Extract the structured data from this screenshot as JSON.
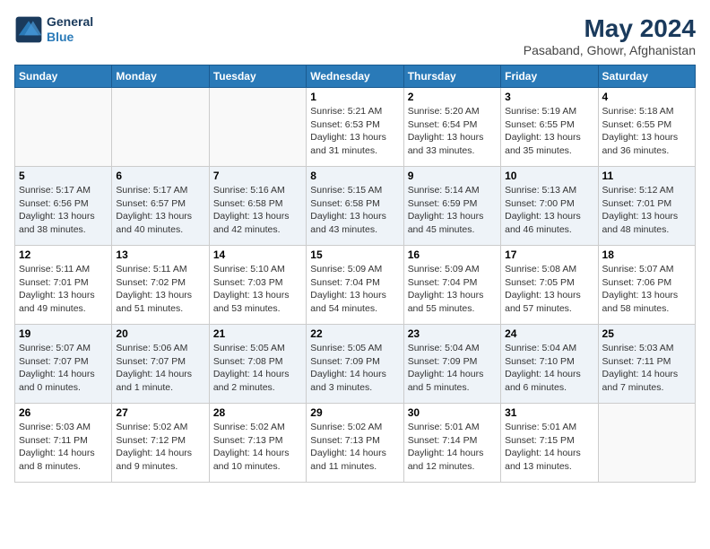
{
  "header": {
    "logo_line1": "General",
    "logo_line2": "Blue",
    "title": "May 2024",
    "subtitle": "Pasaband, Ghowr, Afghanistan"
  },
  "weekdays": [
    "Sunday",
    "Monday",
    "Tuesday",
    "Wednesday",
    "Thursday",
    "Friday",
    "Saturday"
  ],
  "weeks": [
    [
      {
        "day": "",
        "sunrise": "",
        "sunset": "",
        "daylight": ""
      },
      {
        "day": "",
        "sunrise": "",
        "sunset": "",
        "daylight": ""
      },
      {
        "day": "",
        "sunrise": "",
        "sunset": "",
        "daylight": ""
      },
      {
        "day": "1",
        "sunrise": "Sunrise: 5:21 AM",
        "sunset": "Sunset: 6:53 PM",
        "daylight": "Daylight: 13 hours and 31 minutes."
      },
      {
        "day": "2",
        "sunrise": "Sunrise: 5:20 AM",
        "sunset": "Sunset: 6:54 PM",
        "daylight": "Daylight: 13 hours and 33 minutes."
      },
      {
        "day": "3",
        "sunrise": "Sunrise: 5:19 AM",
        "sunset": "Sunset: 6:55 PM",
        "daylight": "Daylight: 13 hours and 35 minutes."
      },
      {
        "day": "4",
        "sunrise": "Sunrise: 5:18 AM",
        "sunset": "Sunset: 6:55 PM",
        "daylight": "Daylight: 13 hours and 36 minutes."
      }
    ],
    [
      {
        "day": "5",
        "sunrise": "Sunrise: 5:17 AM",
        "sunset": "Sunset: 6:56 PM",
        "daylight": "Daylight: 13 hours and 38 minutes."
      },
      {
        "day": "6",
        "sunrise": "Sunrise: 5:17 AM",
        "sunset": "Sunset: 6:57 PM",
        "daylight": "Daylight: 13 hours and 40 minutes."
      },
      {
        "day": "7",
        "sunrise": "Sunrise: 5:16 AM",
        "sunset": "Sunset: 6:58 PM",
        "daylight": "Daylight: 13 hours and 42 minutes."
      },
      {
        "day": "8",
        "sunrise": "Sunrise: 5:15 AM",
        "sunset": "Sunset: 6:58 PM",
        "daylight": "Daylight: 13 hours and 43 minutes."
      },
      {
        "day": "9",
        "sunrise": "Sunrise: 5:14 AM",
        "sunset": "Sunset: 6:59 PM",
        "daylight": "Daylight: 13 hours and 45 minutes."
      },
      {
        "day": "10",
        "sunrise": "Sunrise: 5:13 AM",
        "sunset": "Sunset: 7:00 PM",
        "daylight": "Daylight: 13 hours and 46 minutes."
      },
      {
        "day": "11",
        "sunrise": "Sunrise: 5:12 AM",
        "sunset": "Sunset: 7:01 PM",
        "daylight": "Daylight: 13 hours and 48 minutes."
      }
    ],
    [
      {
        "day": "12",
        "sunrise": "Sunrise: 5:11 AM",
        "sunset": "Sunset: 7:01 PM",
        "daylight": "Daylight: 13 hours and 49 minutes."
      },
      {
        "day": "13",
        "sunrise": "Sunrise: 5:11 AM",
        "sunset": "Sunset: 7:02 PM",
        "daylight": "Daylight: 13 hours and 51 minutes."
      },
      {
        "day": "14",
        "sunrise": "Sunrise: 5:10 AM",
        "sunset": "Sunset: 7:03 PM",
        "daylight": "Daylight: 13 hours and 53 minutes."
      },
      {
        "day": "15",
        "sunrise": "Sunrise: 5:09 AM",
        "sunset": "Sunset: 7:04 PM",
        "daylight": "Daylight: 13 hours and 54 minutes."
      },
      {
        "day": "16",
        "sunrise": "Sunrise: 5:09 AM",
        "sunset": "Sunset: 7:04 PM",
        "daylight": "Daylight: 13 hours and 55 minutes."
      },
      {
        "day": "17",
        "sunrise": "Sunrise: 5:08 AM",
        "sunset": "Sunset: 7:05 PM",
        "daylight": "Daylight: 13 hours and 57 minutes."
      },
      {
        "day": "18",
        "sunrise": "Sunrise: 5:07 AM",
        "sunset": "Sunset: 7:06 PM",
        "daylight": "Daylight: 13 hours and 58 minutes."
      }
    ],
    [
      {
        "day": "19",
        "sunrise": "Sunrise: 5:07 AM",
        "sunset": "Sunset: 7:07 PM",
        "daylight": "Daylight: 14 hours and 0 minutes."
      },
      {
        "day": "20",
        "sunrise": "Sunrise: 5:06 AM",
        "sunset": "Sunset: 7:07 PM",
        "daylight": "Daylight: 14 hours and 1 minute."
      },
      {
        "day": "21",
        "sunrise": "Sunrise: 5:05 AM",
        "sunset": "Sunset: 7:08 PM",
        "daylight": "Daylight: 14 hours and 2 minutes."
      },
      {
        "day": "22",
        "sunrise": "Sunrise: 5:05 AM",
        "sunset": "Sunset: 7:09 PM",
        "daylight": "Daylight: 14 hours and 3 minutes."
      },
      {
        "day": "23",
        "sunrise": "Sunrise: 5:04 AM",
        "sunset": "Sunset: 7:09 PM",
        "daylight": "Daylight: 14 hours and 5 minutes."
      },
      {
        "day": "24",
        "sunrise": "Sunrise: 5:04 AM",
        "sunset": "Sunset: 7:10 PM",
        "daylight": "Daylight: 14 hours and 6 minutes."
      },
      {
        "day": "25",
        "sunrise": "Sunrise: 5:03 AM",
        "sunset": "Sunset: 7:11 PM",
        "daylight": "Daylight: 14 hours and 7 minutes."
      }
    ],
    [
      {
        "day": "26",
        "sunrise": "Sunrise: 5:03 AM",
        "sunset": "Sunset: 7:11 PM",
        "daylight": "Daylight: 14 hours and 8 minutes."
      },
      {
        "day": "27",
        "sunrise": "Sunrise: 5:02 AM",
        "sunset": "Sunset: 7:12 PM",
        "daylight": "Daylight: 14 hours and 9 minutes."
      },
      {
        "day": "28",
        "sunrise": "Sunrise: 5:02 AM",
        "sunset": "Sunset: 7:13 PM",
        "daylight": "Daylight: 14 hours and 10 minutes."
      },
      {
        "day": "29",
        "sunrise": "Sunrise: 5:02 AM",
        "sunset": "Sunset: 7:13 PM",
        "daylight": "Daylight: 14 hours and 11 minutes."
      },
      {
        "day": "30",
        "sunrise": "Sunrise: 5:01 AM",
        "sunset": "Sunset: 7:14 PM",
        "daylight": "Daylight: 14 hours and 12 minutes."
      },
      {
        "day": "31",
        "sunrise": "Sunrise: 5:01 AM",
        "sunset": "Sunset: 7:15 PM",
        "daylight": "Daylight: 14 hours and 13 minutes."
      },
      {
        "day": "",
        "sunrise": "",
        "sunset": "",
        "daylight": ""
      }
    ]
  ]
}
